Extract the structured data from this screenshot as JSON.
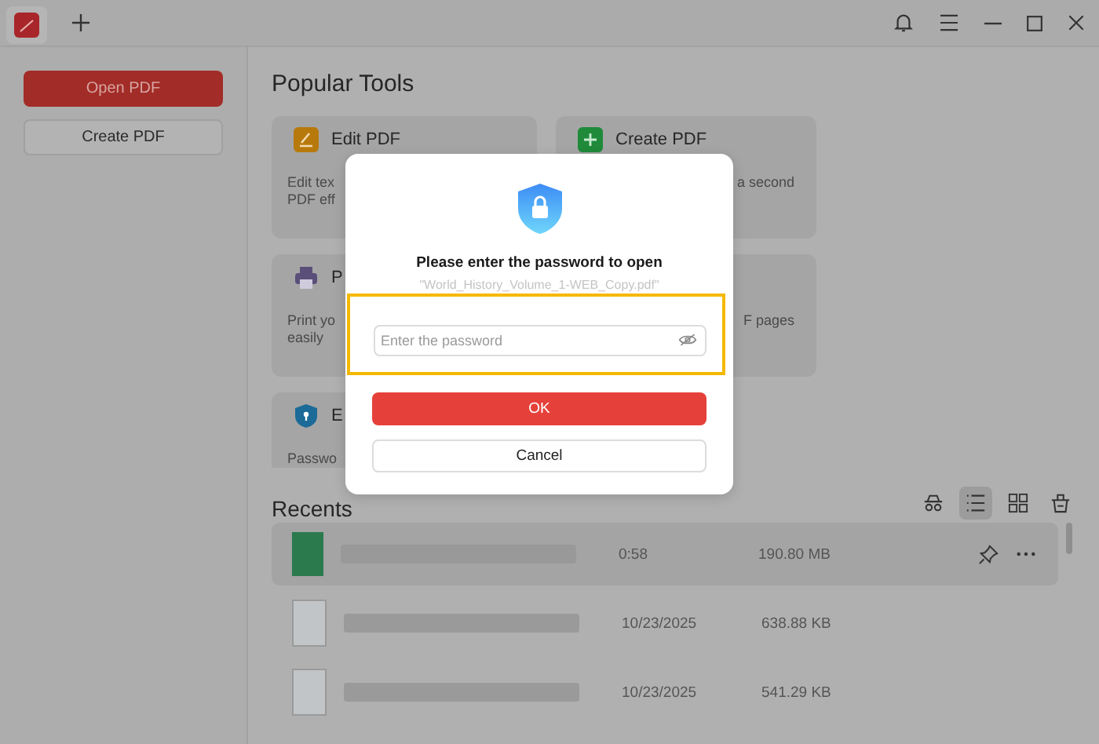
{
  "sidebar": {
    "buttons": [
      {
        "label": "Open PDF",
        "kind": "primary"
      },
      {
        "label": "Create PDF",
        "kind": "secondary"
      }
    ]
  },
  "popular_tools": {
    "title": "Popular Tools",
    "cards": [
      {
        "kind": "edit",
        "title": "Edit PDF",
        "description": [
          "Edit tex",
          "PDF eff"
        ]
      },
      {
        "kind": "create",
        "title": "Create PDF",
        "description": [
          "a second"
        ]
      },
      {
        "kind": "print",
        "title": "P",
        "description": [
          "Print yo",
          "easily"
        ]
      },
      {
        "kind": "pages",
        "description": [
          "F pages"
        ]
      },
      {
        "kind": "protect",
        "title": "E",
        "description": [
          "Passwo"
        ]
      }
    ]
  },
  "recents": {
    "title": "Recents",
    "views": [
      {
        "kind": "filter",
        "selected": false
      },
      {
        "kind": "list",
        "selected": true
      },
      {
        "kind": "grid",
        "selected": false
      },
      {
        "kind": "clean",
        "selected": false
      }
    ],
    "files": [
      {
        "kind": "sheet",
        "selected": true,
        "date": "0:58",
        "size": "190.80 MB"
      },
      {
        "kind": "doc",
        "selected": false,
        "date": "10/23/2025",
        "size": "638.88 KB"
      },
      {
        "kind": "doc",
        "selected": false,
        "date": "10/23/2025",
        "size": "541.29 KB"
      }
    ]
  },
  "dialog": {
    "title": "Please enter the password to open",
    "filename": "\"World_History_Volume_1-WEB_Copy.pdf\"",
    "highlighted": true,
    "password": {
      "placeholder": "Enter the password",
      "visible": false
    },
    "buttons": [
      {
        "label": "OK",
        "kind": "primary"
      },
      {
        "label": "Cancel",
        "kind": "secondary"
      }
    ]
  }
}
